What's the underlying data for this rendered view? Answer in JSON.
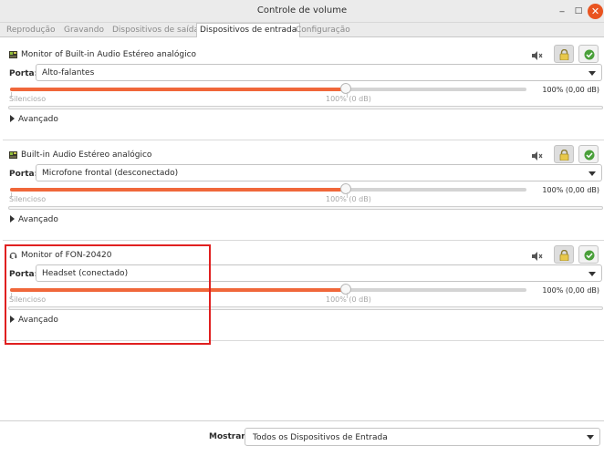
{
  "window": {
    "title": "Controle de volume",
    "min_glyph": "_",
    "max_glyph": "□",
    "close_glyph": "✕"
  },
  "tabs": [
    {
      "label": "Reprodução",
      "active": false
    },
    {
      "label": "Gravando",
      "active": false
    },
    {
      "label": "Dispositivos de saída",
      "active": false
    },
    {
      "label": "Dispositivos de entrada",
      "active": true
    },
    {
      "label": "Configuração",
      "active": false
    }
  ],
  "devices": [
    {
      "name": "Monitor of Built-in Audio Estéreo analógico",
      "icon": "sound-card-icon",
      "port_label": "Porta:",
      "port_value": "Alto-falantes",
      "volume_percent": 100,
      "volume_readout": "100% (0,00 dB)",
      "label_silent": "Silencioso",
      "label_100": "100% (0 dB)",
      "advanced_label": "Avançado",
      "locked": true,
      "default": true
    },
    {
      "name": "Built-in Audio Estéreo analógico",
      "icon": "sound-card-icon",
      "port_label": "Porta:",
      "port_value": "Microfone frontal (desconectado)",
      "volume_percent": 100,
      "volume_readout": "100% (0,00 dB)",
      "label_silent": "Silencioso",
      "label_100": "100% (0 dB)",
      "advanced_label": "Avançado",
      "locked": true,
      "default": true
    },
    {
      "name": "Monitor of FON-20420",
      "icon": "headset-icon",
      "port_label": "Porta:",
      "port_value": "Headset (conectado)",
      "volume_percent": 100,
      "volume_readout": "100% (0,00 dB)",
      "label_silent": "Silencioso",
      "label_100": "100% (0 dB)",
      "advanced_label": "Avançado",
      "locked": true,
      "default": true
    }
  ],
  "footer": {
    "show_label": "Mostrar:",
    "show_value": "Todos os Dispositivos de Entrada"
  },
  "colors": {
    "accent": "#f0673a",
    "close_button": "#e95420",
    "highlight": "#e02020",
    "check_green": "#4aa03a"
  }
}
